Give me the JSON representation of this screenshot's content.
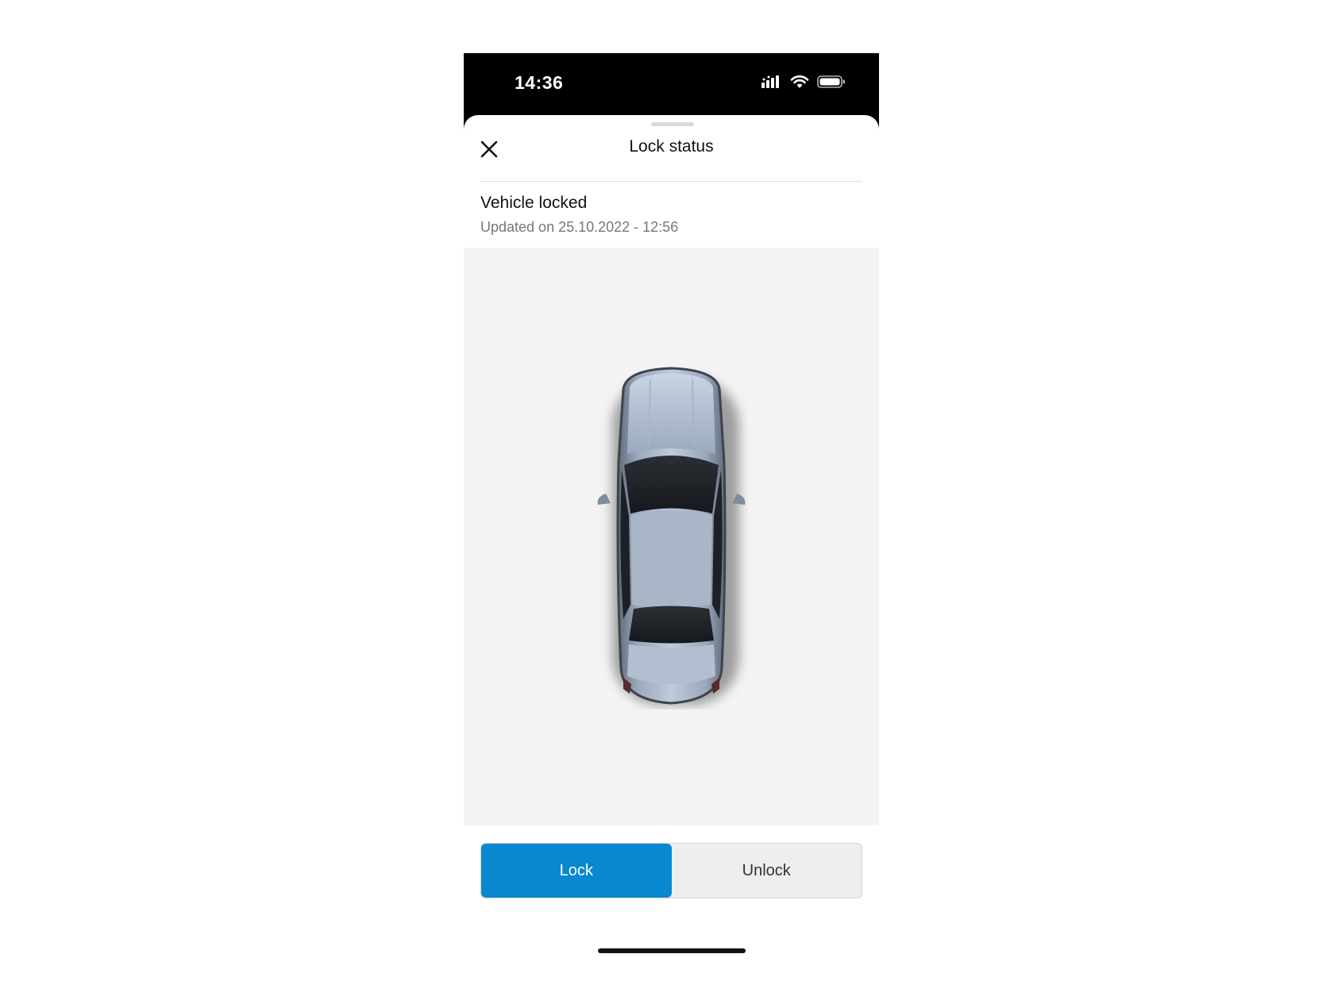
{
  "status_bar": {
    "time": "14:36",
    "icons": [
      "signal-icon",
      "wifi-icon",
      "battery-icon"
    ]
  },
  "sheet": {
    "title": "Lock status",
    "close_icon": "close-icon"
  },
  "lock_info": {
    "headline": "Vehicle locked",
    "updated": "Updated on 25.10.2022 - 12:56"
  },
  "controls": {
    "lock_label": "Lock",
    "unlock_label": "Unlock",
    "selected": "Lock"
  },
  "colors": {
    "accent": "#0a88cf",
    "status_bar": "#000000",
    "vehicle_background": "#f3f3f3"
  }
}
